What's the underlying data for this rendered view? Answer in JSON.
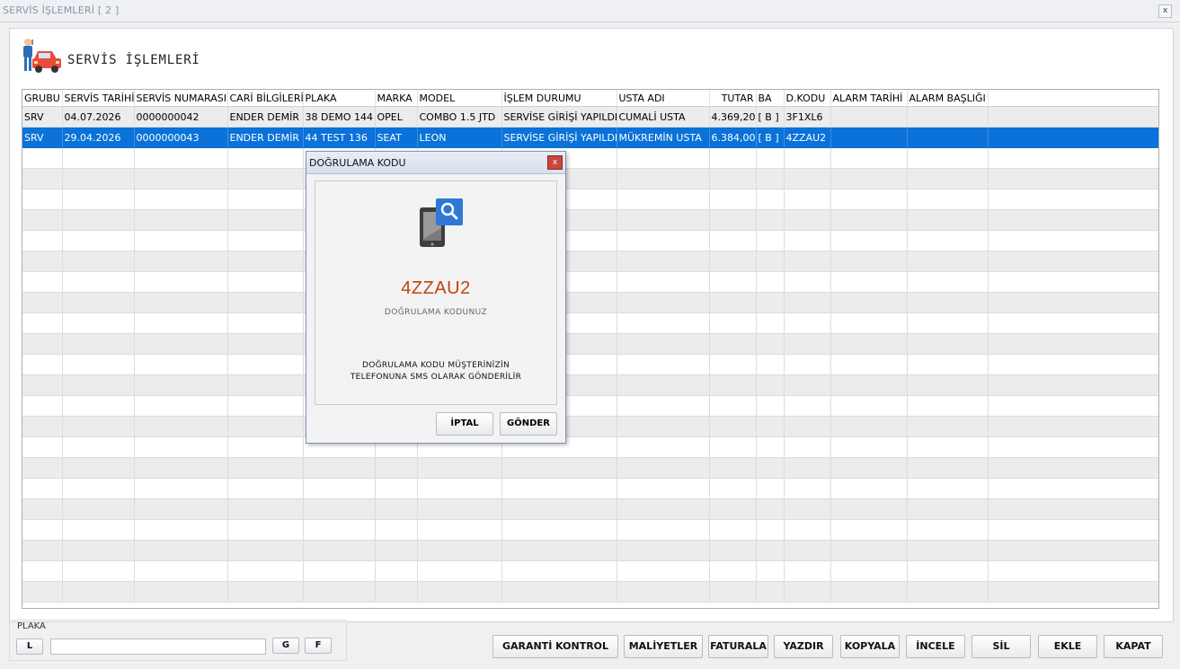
{
  "window": {
    "title": "SERVİS İŞLEMLERİ [ 2 ]",
    "close_label": "x"
  },
  "header": {
    "title": "SERVİS İŞLEMLERİ",
    "icon": "car-mechanic-icon"
  },
  "grid": {
    "columns": [
      "GRUBU",
      "SERVİS TARİHİ",
      "SERVİS NUMARASI",
      "CARİ BİLGİLERİ",
      "PLAKA",
      "MARKA",
      "MODEL",
      "İŞLEM DURUMU",
      "USTA ADI",
      "TUTAR",
      "BA",
      "D.KODU",
      "ALARM TARİHİ",
      "ALARM BAŞLIĞI"
    ],
    "rows": [
      [
        "SRV",
        "04.07.2026",
        "0000000042",
        "ENDER DEMİR",
        "38 DEMO 144",
        "OPEL",
        "COMBO 1.5 JTD",
        "SERVİSE GİRİŞİ YAPILDI",
        "CUMALİ USTA",
        "4.369,20",
        "[ B ]",
        "3F1XL6",
        "",
        ""
      ],
      [
        "SRV",
        "29.04.2026",
        "0000000043",
        "ENDER DEMİR",
        "44 TEST 136",
        "SEAT",
        "LEON",
        "SERVİSE GİRİŞİ YAPILDI",
        "MÜKREMİN USTA",
        "6.384,00",
        "[ B ]",
        "4ZZAU2",
        "",
        ""
      ]
    ],
    "selected_row": 1
  },
  "dialog": {
    "title": "DOĞRULAMA KODU",
    "close_label": "x",
    "icon": "phone-search-icon",
    "code": "4ZZAU2",
    "code_label": "DOĞRULAMA KODUNUZ",
    "message_line1": "DOĞRULAMA KODU MÜŞTERİNİZİN",
    "message_line2": "TELEFONUNA SMS OLARAK GÖNDERİLİR",
    "cancel_label": "İPTAL",
    "send_label": "GÖNDER"
  },
  "plaka": {
    "label": "PLAKA",
    "l_label": "L",
    "value": "",
    "g_label": "G",
    "f_label": "F"
  },
  "buttons": {
    "garanti": "GARANTİ KONTROL",
    "maliyetler": "MALİYETLER",
    "faturala": "FATURALA",
    "yazdir": "YAZDIR",
    "kopyala": "KOPYALA",
    "incele": "İNCELE",
    "sil": "SİL",
    "ekle": "EKLE",
    "kapat": "KAPAT"
  },
  "colors": {
    "selection": "#0a72d8",
    "code": "#c1440e",
    "dialog_close": "#c9463d"
  }
}
